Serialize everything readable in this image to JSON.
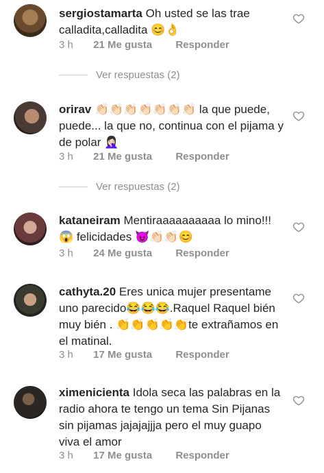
{
  "comments": [
    {
      "username": "sergiostamarta",
      "text": "Oh usted se las trae calladita,calladita 😊👌",
      "time": "3 h",
      "likes": "21 Me gusta",
      "reply": "Responder",
      "view_replies": "Ver respuestas (2)",
      "avatar_color": "#7a5a3a"
    },
    {
      "username": "orirav",
      "text": "👏🏻👏🏻👏🏻👏🏻👏🏻👏🏻👏🏻 la que puede, puede... la que no, continua con el pijama y de polar 🤦🏻‍♀️",
      "time": "3 h",
      "likes": "21 Me gusta",
      "reply": "Responder",
      "view_replies": "Ver respuestas (2)",
      "avatar_color": "#4a3a34"
    },
    {
      "username": "kataneiram",
      "text": "Mentiraaaaaaaaaa lo mino!!! 😱 felicidades 😈👏🏻👏🏻😊",
      "time": "3 h",
      "likes": "24 Me gusta",
      "reply": "Responder",
      "avatar_color": "#6b3b3b"
    },
    {
      "username": "cathyta.20",
      "text": "Eres unica mujer presentame uno parecido😂😂😂.Raquel Raquel bién muy bién . 👏👏👏👏👏te extrañamos en el matinal.",
      "time": "3 h",
      "likes": "17 Me gusta",
      "reply": "Responder",
      "avatar_color": "#3a3a2e"
    },
    {
      "username": "ximenicienta",
      "text": "Idola seca las palabras en la radio ahora te tengo un tema Sin Pijanas sin pijamas jajajajjja pero el muy guapo viva el amor",
      "time": "3 h",
      "likes": "17 Me gusta",
      "reply": "Responder",
      "avatar_color": "#2a2622"
    }
  ],
  "colors": {
    "text": "#262626",
    "muted": "#8e8e8e"
  }
}
